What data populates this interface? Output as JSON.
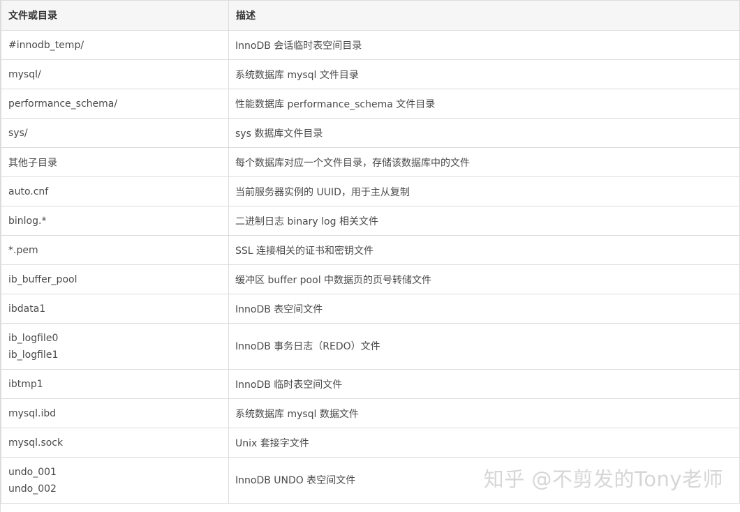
{
  "table": {
    "headers": [
      "文件或目录",
      "描述"
    ],
    "rows": [
      {
        "name": [
          "#innodb_temp/"
        ],
        "desc": "InnoDB 会话临时表空间目录"
      },
      {
        "name": [
          "mysql/"
        ],
        "desc": "系统数据库 mysql 文件目录"
      },
      {
        "name": [
          "performance_schema/"
        ],
        "desc": "性能数据库 performance_schema 文件目录"
      },
      {
        "name": [
          "sys/"
        ],
        "desc": "sys 数据库文件目录"
      },
      {
        "name": [
          "其他子目录"
        ],
        "desc": "每个数据库对应一个文件目录，存储该数据库中的文件"
      },
      {
        "name": [
          "auto.cnf"
        ],
        "desc": "当前服务器实例的 UUID，用于主从复制"
      },
      {
        "name": [
          "binlog.*"
        ],
        "desc": "二进制日志 binary log 相关文件"
      },
      {
        "name": [
          "*.pem"
        ],
        "desc": "SSL 连接相关的证书和密钥文件"
      },
      {
        "name": [
          "ib_buffer_pool"
        ],
        "desc": "缓冲区 buffer pool 中数据页的页号转储文件"
      },
      {
        "name": [
          "ibdata1"
        ],
        "desc": "InnoDB 表空间文件"
      },
      {
        "name": [
          "ib_logfile0",
          "ib_logfile1"
        ],
        "desc": "InnoDB 事务日志（REDO）文件"
      },
      {
        "name": [
          "ibtmp1"
        ],
        "desc": "InnoDB 临时表空间文件"
      },
      {
        "name": [
          "mysql.ibd"
        ],
        "desc": "系统数据库 mysql 数据文件"
      },
      {
        "name": [
          "mysql.sock"
        ],
        "desc": "Unix 套接字文件"
      },
      {
        "name": [
          "undo_001",
          "undo_002"
        ],
        "desc": "InnoDB UNDO 表空间文件"
      }
    ]
  },
  "watermark": "知乎 @不剪发的Tony老师"
}
